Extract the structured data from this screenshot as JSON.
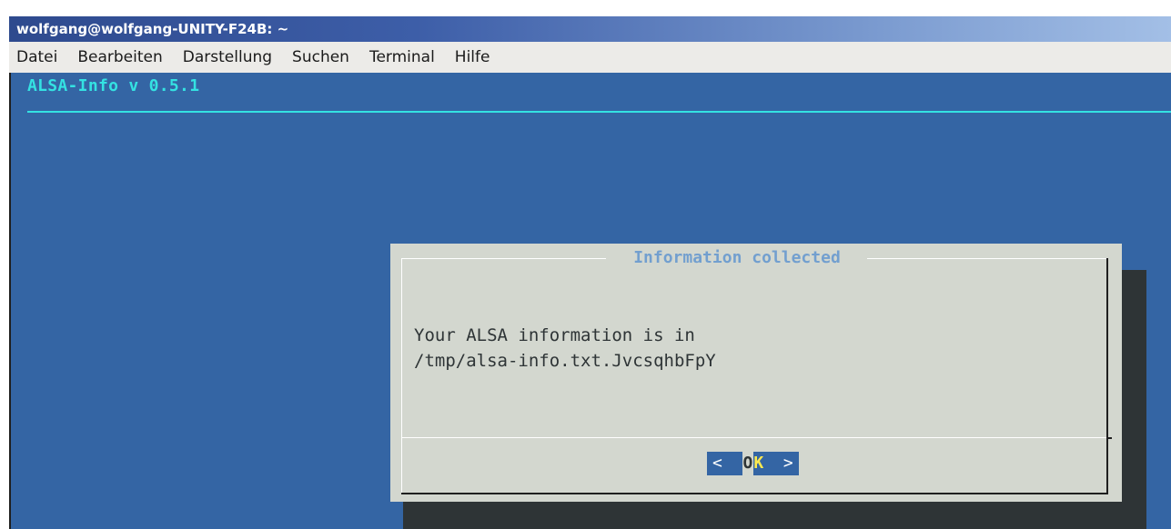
{
  "window": {
    "title": "wolfgang@wolfgang-UNITY-F24B: ~"
  },
  "menubar": {
    "items": [
      "Datei",
      "Bearbeiten",
      "Darstellung",
      "Suchen",
      "Terminal",
      "Hilfe"
    ]
  },
  "terminal": {
    "header": "ALSA-Info v 0.5.1",
    "colors": {
      "background": "#3465a4",
      "header": "#34e2e2",
      "dialog_bg": "#d3d7cf",
      "dialog_title": "#729fcf",
      "hotkey": "#fce94f"
    }
  },
  "dialog": {
    "title": "Information collected",
    "line1": "Your ALSA information is in",
    "line2": "/tmp/alsa-info.txt.JvcsqhbFpY",
    "button": {
      "left": "<  ",
      "o": "O",
      "k": "K",
      "right": "  >"
    }
  }
}
